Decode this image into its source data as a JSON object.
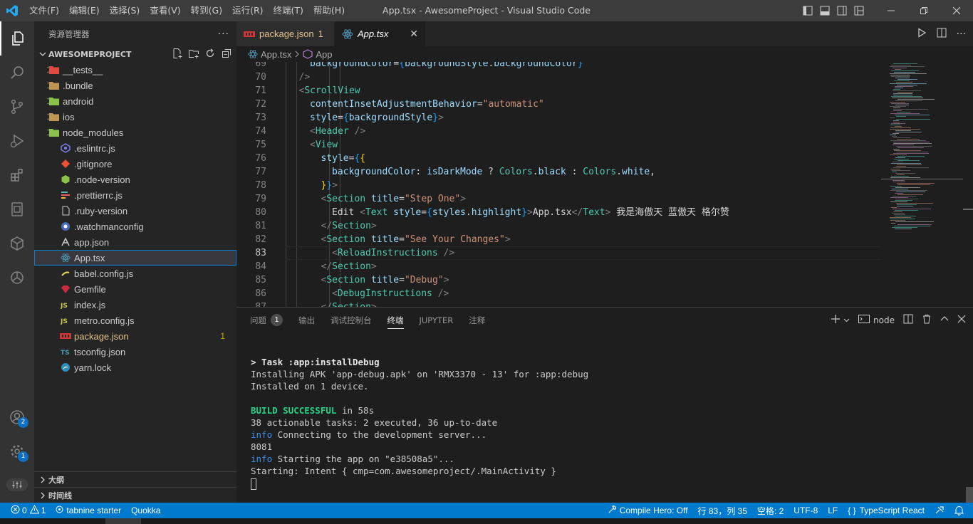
{
  "window": {
    "title": "App.tsx - AwesomeProject - Visual Studio Code",
    "menu": [
      "文件(F)",
      "编辑(E)",
      "选择(S)",
      "查看(V)",
      "转到(G)",
      "运行(R)",
      "终端(T)",
      "帮助(H)"
    ]
  },
  "activity_bar": {
    "items": [
      {
        "name": "explorer-icon",
        "active": true
      },
      {
        "name": "search-icon"
      },
      {
        "name": "source-control-icon"
      },
      {
        "name": "run-debug-icon"
      },
      {
        "name": "extensions-icon"
      },
      {
        "name": "remote-explorer-icon"
      },
      {
        "name": "docker-icon"
      },
      {
        "name": "openai-icon"
      }
    ],
    "account_badge": "2",
    "settings_badge": "1"
  },
  "sidebar": {
    "header": "资源管理器",
    "more": "···",
    "project": "AWESOMEPROJECT",
    "tree": [
      {
        "label": "__tests__",
        "type": "folder",
        "icon_color": "#e04a3f"
      },
      {
        "label": ".bundle",
        "type": "folder",
        "icon_color": "#c09553"
      },
      {
        "label": "android",
        "type": "folder",
        "icon_color": "#8bc34a"
      },
      {
        "label": "ios",
        "type": "folder",
        "icon_color": "#c09553"
      },
      {
        "label": "node_modules",
        "type": "folder",
        "icon_color": "#8bc34a"
      },
      {
        "label": ".eslintrc.js",
        "type": "file",
        "icon": "eslint"
      },
      {
        "label": ".gitignore",
        "type": "file",
        "icon": "git"
      },
      {
        "label": ".node-version",
        "type": "file",
        "icon": "node"
      },
      {
        "label": ".prettierrc.js",
        "type": "file",
        "icon": "prettier"
      },
      {
        "label": ".ruby-version",
        "type": "file",
        "icon": "file"
      },
      {
        "label": ".watchmanconfig",
        "type": "file",
        "icon": "watchman"
      },
      {
        "label": "app.json",
        "type": "file",
        "icon": "app"
      },
      {
        "label": "App.tsx",
        "type": "file",
        "icon": "react",
        "selected": true
      },
      {
        "label": "babel.config.js",
        "type": "file",
        "icon": "babel"
      },
      {
        "label": "Gemfile",
        "type": "file",
        "icon": "gem"
      },
      {
        "label": "index.js",
        "type": "file",
        "icon": "js"
      },
      {
        "label": "metro.config.js",
        "type": "file",
        "icon": "js"
      },
      {
        "label": "package.json",
        "type": "file",
        "icon": "npm",
        "modified": true,
        "count": "1"
      },
      {
        "label": "tsconfig.json",
        "type": "file",
        "icon": "ts"
      },
      {
        "label": "yarn.lock",
        "type": "file",
        "icon": "yarn"
      }
    ],
    "outline": "大纲",
    "timeline": "时间线"
  },
  "tabs": [
    {
      "label": "package.json",
      "count": "1",
      "active": false
    },
    {
      "label": "App.tsx",
      "close": "✕",
      "active": true
    }
  ],
  "breadcrumb": [
    "App.tsx",
    "App"
  ],
  "code": {
    "lines": [
      {
        "n": "69",
        "indent": 2,
        "tokens": [
          [
            "tk-attr",
            "backgroundColor"
          ],
          [
            "tk-punc",
            "="
          ],
          [
            "tk-brace3",
            "{"
          ],
          [
            "tk-var",
            "backgroundStyle"
          ],
          [
            "tk-punc",
            "."
          ],
          [
            "tk-var",
            "backgroundColor"
          ],
          [
            "tk-brace3",
            "}"
          ]
        ]
      },
      {
        "n": "70",
        "indent": 1,
        "tokens": [
          [
            "tk-br",
            "/>"
          ]
        ]
      },
      {
        "n": "71",
        "indent": 1,
        "tokens": [
          [
            "tk-br",
            "<"
          ],
          [
            "tk-tag",
            "ScrollView"
          ]
        ]
      },
      {
        "n": "72",
        "indent": 2,
        "tokens": [
          [
            "tk-attr",
            "contentInsetAdjustmentBehavior"
          ],
          [
            "tk-punc",
            "="
          ],
          [
            "tk-str",
            "\"automatic\""
          ]
        ]
      },
      {
        "n": "73",
        "indent": 2,
        "tokens": [
          [
            "tk-attr",
            "style"
          ],
          [
            "tk-punc",
            "="
          ],
          [
            "tk-brace3",
            "{"
          ],
          [
            "tk-var",
            "backgroundStyle"
          ],
          [
            "tk-brace3",
            "}"
          ],
          [
            "tk-br",
            ">"
          ]
        ]
      },
      {
        "n": "74",
        "indent": 2,
        "tokens": [
          [
            "tk-br",
            "<"
          ],
          [
            "tk-tag",
            "Header"
          ],
          [
            "tk-br",
            " />"
          ]
        ]
      },
      {
        "n": "75",
        "indent": 2,
        "tokens": [
          [
            "tk-br",
            "<"
          ],
          [
            "tk-tag",
            "View"
          ]
        ]
      },
      {
        "n": "76",
        "indent": 3,
        "tokens": [
          [
            "tk-attr",
            "style"
          ],
          [
            "tk-punc",
            "="
          ],
          [
            "tk-brace3",
            "{"
          ],
          [
            "tk-brace2",
            "{"
          ]
        ]
      },
      {
        "n": "77",
        "indent": 4,
        "tokens": [
          [
            "tk-attr",
            "backgroundColor"
          ],
          [
            "tk-punc",
            ": "
          ],
          [
            "tk-var",
            "isDarkMode"
          ],
          [
            "tk-punc",
            " ? "
          ],
          [
            "tk-cls",
            "Colors"
          ],
          [
            "tk-punc",
            "."
          ],
          [
            "tk-var",
            "black"
          ],
          [
            "tk-punc",
            " : "
          ],
          [
            "tk-cls",
            "Colors"
          ],
          [
            "tk-punc",
            "."
          ],
          [
            "tk-var",
            "white"
          ],
          [
            "tk-punc",
            ","
          ]
        ]
      },
      {
        "n": "78",
        "indent": 3,
        "tokens": [
          [
            "tk-brace2",
            "}"
          ],
          [
            "tk-brace3",
            "}"
          ],
          [
            "tk-br",
            ">"
          ]
        ]
      },
      {
        "n": "79",
        "indent": 3,
        "tokens": [
          [
            "tk-br",
            "<"
          ],
          [
            "tk-tag",
            "Section"
          ],
          [
            "tk-attr",
            " title"
          ],
          [
            "tk-punc",
            "="
          ],
          [
            "tk-str",
            "\"Step One\""
          ],
          [
            "tk-br",
            ">"
          ]
        ]
      },
      {
        "n": "80",
        "indent": 4,
        "tokens": [
          [
            "tk-text",
            "Edit "
          ],
          [
            "tk-br",
            "<"
          ],
          [
            "tk-tag",
            "Text"
          ],
          [
            "tk-attr",
            " style"
          ],
          [
            "tk-punc",
            "="
          ],
          [
            "tk-brace3",
            "{"
          ],
          [
            "tk-var",
            "styles"
          ],
          [
            "tk-punc",
            "."
          ],
          [
            "tk-var",
            "highlight"
          ],
          [
            "tk-brace3",
            "}"
          ],
          [
            "tk-br",
            ">"
          ],
          [
            "tk-text",
            "App.tsx"
          ],
          [
            "tk-br",
            "</"
          ],
          [
            "tk-tag",
            "Text"
          ],
          [
            "tk-br",
            ">"
          ],
          [
            "tk-text",
            " 我是海傲天 蓝傲天 格尔赞"
          ]
        ]
      },
      {
        "n": "81",
        "indent": 3,
        "tokens": [
          [
            "tk-br",
            "</"
          ],
          [
            "tk-tag",
            "Section"
          ],
          [
            "tk-br",
            ">"
          ]
        ]
      },
      {
        "n": "82",
        "indent": 3,
        "tokens": [
          [
            "tk-br",
            "<"
          ],
          [
            "tk-tag",
            "Section"
          ],
          [
            "tk-attr",
            " title"
          ],
          [
            "tk-punc",
            "="
          ],
          [
            "tk-str",
            "\"See Your Changes\""
          ],
          [
            "tk-br",
            ">"
          ]
        ]
      },
      {
        "n": "83",
        "indent": 4,
        "current": true,
        "tokens": [
          [
            "tk-br",
            "<"
          ],
          [
            "tk-tag",
            "ReloadInstructions"
          ],
          [
            "tk-br",
            " />"
          ]
        ]
      },
      {
        "n": "84",
        "indent": 3,
        "tokens": [
          [
            "tk-br",
            "</"
          ],
          [
            "tk-tag",
            "Section"
          ],
          [
            "tk-br",
            ">"
          ]
        ]
      },
      {
        "n": "85",
        "indent": 3,
        "tokens": [
          [
            "tk-br",
            "<"
          ],
          [
            "tk-tag",
            "Section"
          ],
          [
            "tk-attr",
            " title"
          ],
          [
            "tk-punc",
            "="
          ],
          [
            "tk-str",
            "\"Debug\""
          ],
          [
            "tk-br",
            ">"
          ]
        ]
      },
      {
        "n": "86",
        "indent": 4,
        "tokens": [
          [
            "tk-br",
            "<"
          ],
          [
            "tk-tag",
            "DebugInstructions"
          ],
          [
            "tk-br",
            " />"
          ]
        ]
      },
      {
        "n": "87",
        "indent": 3,
        "tokens": [
          [
            "tk-br",
            "</"
          ],
          [
            "tk-tag",
            "Section"
          ],
          [
            "tk-br",
            ">"
          ]
        ]
      }
    ]
  },
  "panel": {
    "tabs": [
      {
        "label": "问题",
        "badge": "1"
      },
      {
        "label": "输出"
      },
      {
        "label": "调试控制台"
      },
      {
        "label": "终端",
        "active": true
      },
      {
        "label": "JUPYTER"
      },
      {
        "label": "注释"
      }
    ],
    "terminal_name": "node",
    "lines": [
      [
        [
          "t-bold",
          "> Task :app:installDebug"
        ]
      ],
      [
        [
          "",
          "Installing APK 'app-debug.apk' on 'RMX3370 - 13' for :app:debug"
        ]
      ],
      [
        [
          "",
          "Installed on 1 device."
        ]
      ],
      [
        [
          "",
          ""
        ]
      ],
      [
        [
          "t-green",
          "BUILD SUCCESSFUL"
        ],
        [
          "",
          " in 58s"
        ]
      ],
      [
        [
          "",
          "38 actionable tasks: 2 executed, 36 up-to-date"
        ]
      ],
      [
        [
          "t-blue",
          "info"
        ],
        [
          "",
          " Connecting to the development server..."
        ]
      ],
      [
        [
          "",
          "8081"
        ]
      ],
      [
        [
          "t-blue",
          "info"
        ],
        [
          "",
          " Starting the app on \"e38508a5\"..."
        ]
      ],
      [
        [
          "",
          "Starting: Intent { cmp=com.awesomeproject/.MainActivity }"
        ]
      ]
    ]
  },
  "status": {
    "errors": "0",
    "warnings": "1",
    "tabnine": "tabnine starter",
    "quokka": "Quokka",
    "compile_hero": "Compile Hero: Off",
    "position": "行 83，列 35",
    "spaces": "空格: 2",
    "encoding": "UTF-8",
    "eol": "LF",
    "language": "TypeScript React"
  }
}
